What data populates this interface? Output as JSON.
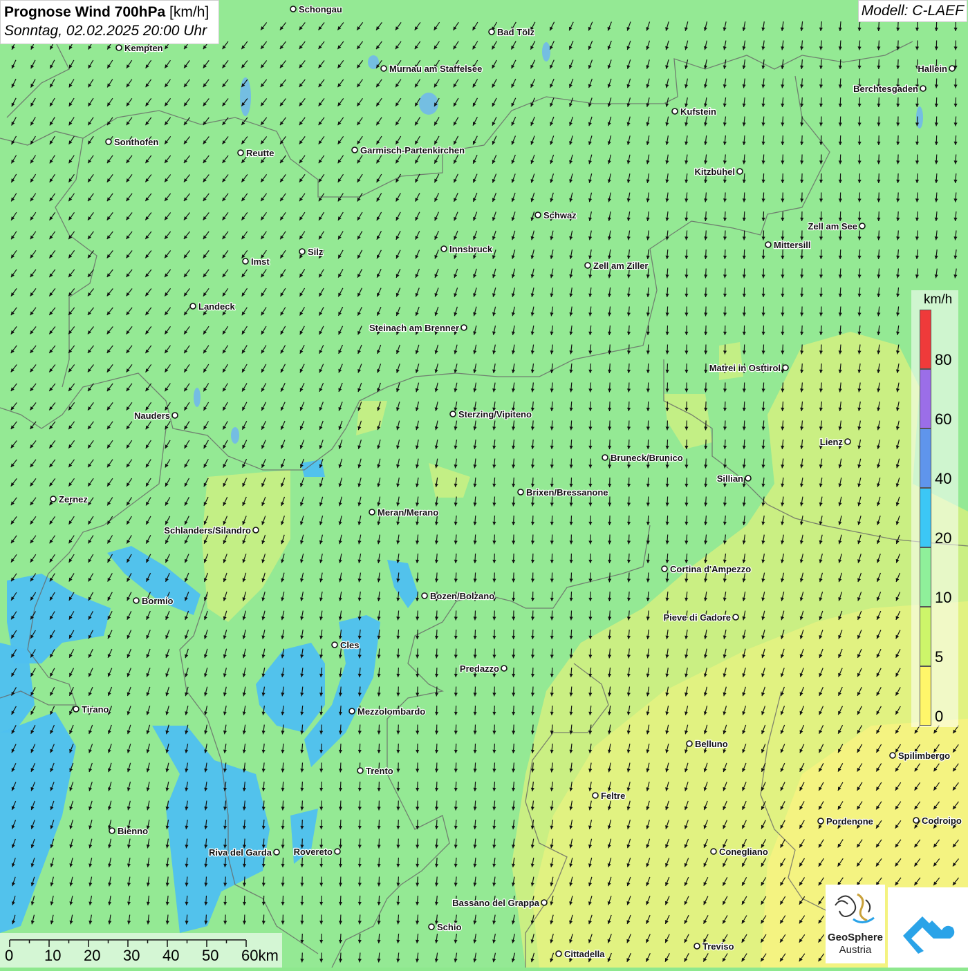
{
  "header": {
    "title_bold": "Prognose Wind 700hPa",
    "title_unit": "[km/h]",
    "datetime": "Sonntag, 02.02.2025 20:00 Uhr",
    "model": "Modell: C-LAEF"
  },
  "legend": {
    "unit": "km/h",
    "classes": [
      {
        "label": "80",
        "color": "#ef3a3a"
      },
      {
        "label": "60",
        "color": "#9b6ee8"
      },
      {
        "label": "40",
        "color": "#5f95ec"
      },
      {
        "label": "20",
        "color": "#3cc7f5"
      },
      {
        "label": "10",
        "color": "#8ff09a"
      },
      {
        "label": "5",
        "color": "#cdf56a"
      },
      {
        "label": "0",
        "color": "#fff66a"
      }
    ]
  },
  "scale_bar": {
    "labels": [
      "0",
      "10",
      "20",
      "30",
      "40",
      "50",
      "60km"
    ]
  },
  "logos": {
    "geosphere_line1": "GeoSphere",
    "geosphere_line2": "Austria"
  },
  "colors": {
    "green": "#8ee88e",
    "yellow_green": "#cdf07a",
    "yellow": "#f4f27a",
    "blue": "#44bdf0",
    "border": "#666666",
    "arrow": "#111111",
    "geosphere_blue": "#2aa3e8"
  },
  "cities": [
    {
      "name": "Schongau",
      "side": "right"
    },
    {
      "name": "Bad Tölz",
      "side": "right"
    },
    {
      "name": "Kempten",
      "side": "right"
    },
    {
      "name": "Murnau am Staffelsee",
      "side": "right"
    },
    {
      "name": "Hallein",
      "side": "left"
    },
    {
      "name": "Berchtesgaden",
      "side": "left"
    },
    {
      "name": "Kufstein",
      "side": "right"
    },
    {
      "name": "Sonthofen",
      "side": "right"
    },
    {
      "name": "Reutte",
      "side": "right"
    },
    {
      "name": "Garmisch-Partenkirchen",
      "side": "right"
    },
    {
      "name": "Kitzbühel",
      "side": "left"
    },
    {
      "name": "Schwaz",
      "side": "right"
    },
    {
      "name": "Zell am See",
      "side": "left"
    },
    {
      "name": "Mittersill",
      "side": "right"
    },
    {
      "name": "Innsbruck",
      "side": "right"
    },
    {
      "name": "Silz",
      "side": "right"
    },
    {
      "name": "Imst",
      "side": "right"
    },
    {
      "name": "Zell am Ziller",
      "side": "right"
    },
    {
      "name": "Landeck",
      "side": "right"
    },
    {
      "name": "Steinach am Brenner",
      "side": "left"
    },
    {
      "name": "Matrei in Osttirol",
      "side": "left"
    },
    {
      "name": "Nauders",
      "side": "left"
    },
    {
      "name": "Sterzing/Vipiteno",
      "side": "right"
    },
    {
      "name": "Lienz",
      "side": "left"
    },
    {
      "name": "Bruneck/Brunico",
      "side": "right"
    },
    {
      "name": "Sillian",
      "side": "left"
    },
    {
      "name": "Brixen/Bressanone",
      "side": "right"
    },
    {
      "name": "Zernez",
      "side": "right"
    },
    {
      "name": "Meran/Merano",
      "side": "right"
    },
    {
      "name": "Schlanders/Silandro",
      "side": "left"
    },
    {
      "name": "Cortina d'Ampezzo",
      "side": "right"
    },
    {
      "name": "Bozen/Bolzano",
      "side": "right"
    },
    {
      "name": "Bormio",
      "side": "right"
    },
    {
      "name": "Pieve di Cadore",
      "side": "left"
    },
    {
      "name": "Cles",
      "side": "right"
    },
    {
      "name": "Predazzo",
      "side": "left"
    },
    {
      "name": "Tirano",
      "side": "right"
    },
    {
      "name": "Mezzolombardo",
      "side": "right"
    },
    {
      "name": "Belluno",
      "side": "right"
    },
    {
      "name": "Spilimbergo",
      "side": "right"
    },
    {
      "name": "Trento",
      "side": "right"
    },
    {
      "name": "Feltre",
      "side": "right"
    },
    {
      "name": "Pordenone",
      "side": "right"
    },
    {
      "name": "Codroipo",
      "side": "right"
    },
    {
      "name": "Bienno",
      "side": "right"
    },
    {
      "name": "Riva del Garda",
      "side": "left"
    },
    {
      "name": "Rovereto",
      "side": "left"
    },
    {
      "name": "Conegliano",
      "side": "right"
    },
    {
      "name": "Bassano del Grappa",
      "side": "left"
    },
    {
      "name": "Schio",
      "side": "right"
    },
    {
      "name": "Treviso",
      "side": "right"
    },
    {
      "name": "Cittadella",
      "side": "right"
    }
  ]
}
